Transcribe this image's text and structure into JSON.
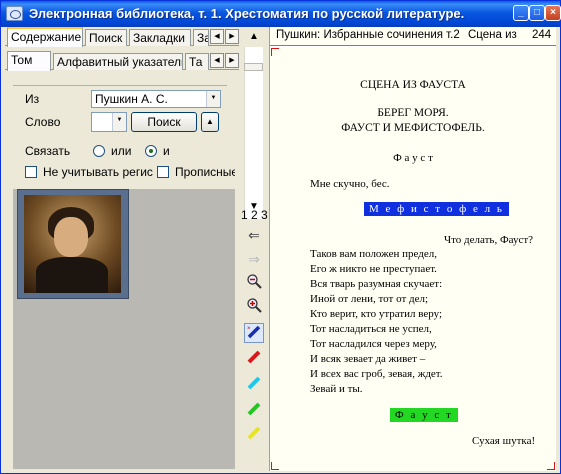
{
  "window": {
    "title": "Электронная библиотека, т. 1. Хрестоматия по русской литературе.",
    "icon": "library-app-icon"
  },
  "left_panel": {
    "tabs": [
      "Содержание",
      "Поиск",
      "Закладки",
      "За"
    ],
    "subtabs": [
      "Том",
      "Алфавитный указатель",
      "Та"
    ],
    "search_form": {
      "from_label": "Из",
      "from_value": "Пушкин А. С.",
      "word_label": "Слово",
      "word_value": "",
      "search_button": "Поиск",
      "link_label": "Связать",
      "or_label": "или",
      "and_label": "и",
      "link_selected": "и",
      "ignore_case_label": "Не учитывать регистр",
      "caps_label": "Прописные"
    },
    "portrait": "pushkin-portrait-image"
  },
  "toolbar": {
    "page_numbers": "1 2 3",
    "tools": [
      "back-arrow-icon",
      "forward-arrow-icon",
      "zoom-out-icon",
      "zoom-in-icon",
      "clear-highlight-icon",
      "red-marker-icon",
      "cyan-marker-icon",
      "green-marker-icon",
      "yellow-marker-icon"
    ]
  },
  "document": {
    "header_title": "Пушкин: Избранные сочинения т.2",
    "header_scene": "Сцена из",
    "header_page": "244",
    "scene_title": "СЦЕНА ИЗ ФАУСТА",
    "setting_line1": "БЕРЕГ МОРЯ.",
    "setting_line2": "ФАУСТ И МЕФИСТОФЕЛЬ.",
    "speaker1": "Ф а у с т",
    "line1": "Мне скучно, бес.",
    "speaker2": "М е ф и с т о ф е л ь",
    "line2_right": "Что делать, Фауст?",
    "verse": [
      "Таков вам положен предел,",
      "Его ж никто не преступает.",
      "Вся тварь разумная скучает:",
      "Иной от лени, тот от дел;",
      "Кто верит, кто утратил веру;",
      "Тот насладиться не успел,",
      "Тот насладился через меру,",
      "И всяк зевает да живет –",
      "И всех вас гроб, зевая, ждет.",
      "Зевай и ты."
    ],
    "speaker3": "Ф а у с т",
    "line3_right": "Сухая шутка!"
  }
}
